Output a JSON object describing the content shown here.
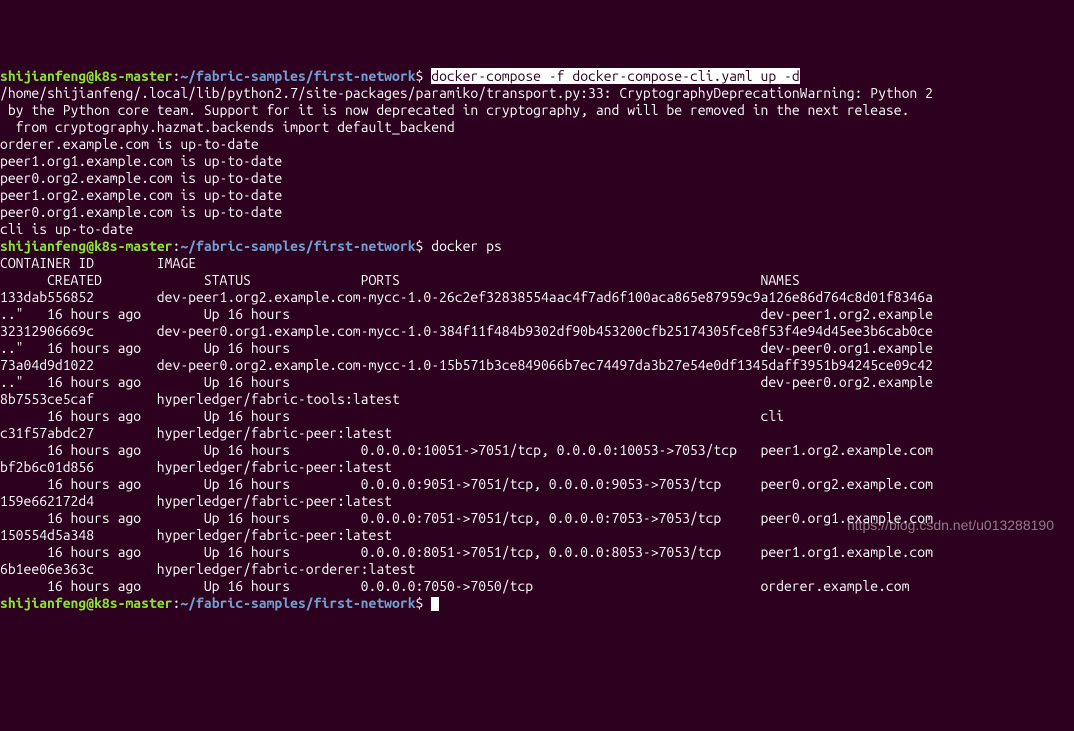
{
  "prompt": {
    "user": "shijianfeng",
    "at": "@",
    "host": "k8s-master",
    "colon": ":",
    "path": "~/fabric-samples/first-network",
    "dollar": "$"
  },
  "cmd1_hl": "docker-compose -f docker-compose-cli.yaml up -d",
  "warn_line1": "/home/shijianfeng/.local/lib/python2.7/site-packages/paramiko/transport.py:33: CryptographyDeprecationWarning: Python 2",
  "warn_line2": " by the Python core team. Support for it is now deprecated in cryptography, and will be removed in the next release.",
  "warn_line3": "  from cryptography.hazmat.backends import default_backend",
  "up": [
    "orderer.example.com is up-to-date",
    "peer1.org1.example.com is up-to-date",
    "peer0.org2.example.com is up-to-date",
    "peer1.org2.example.com is up-to-date",
    "peer0.org1.example.com is up-to-date",
    "cli is up-to-date"
  ],
  "cmd2": "docker ps",
  "ps_head1": "CONTAINER ID        IMAGE                                                                                                             ",
  "ps_head2": "      CREATED             STATUS              PORTS                                              NAMES",
  "rows": [
    {
      "a": "133dab556852        dev-peer1.org2.example.com-mycc-1.0-26c2ef32838554aac4f7ad6f100aca865e87959c9a126e86d764c8d01f8346a",
      "b": "..\"   16 hours ago        Up 16 hours                                                            dev-peer1.org2.example"
    },
    {
      "a": "32312906669c        dev-peer0.org1.example.com-mycc-1.0-384f11f484b9302df90b453200cfb25174305fce8f53f4e94d45ee3b6cab0ce",
      "b": "..\"   16 hours ago        Up 16 hours                                                            dev-peer0.org1.example"
    },
    {
      "a": "73a04d9d1022        dev-peer0.org2.example.com-mycc-1.0-15b571b3ce849066b7ec74497da3b27e54e0df1345daff3951b94245ce09c42",
      "b": "..\"   16 hours ago        Up 16 hours                                                            dev-peer0.org2.example"
    },
    {
      "a": "8b7553ce5caf        hyperledger/fabric-tools:latest                                                                   ",
      "b": "      16 hours ago        Up 16 hours                                                            cli"
    },
    {
      "a": "c31f57abdc27        hyperledger/fabric-peer:latest                                                                    ",
      "b": "      16 hours ago        Up 16 hours         0.0.0.0:10051->7051/tcp, 0.0.0.0:10053->7053/tcp   peer1.org2.example.com"
    },
    {
      "a": "bf2b6c01d856        hyperledger/fabric-peer:latest                                                                    ",
      "b": "      16 hours ago        Up 16 hours         0.0.0.0:9051->7051/tcp, 0.0.0.0:9053->7053/tcp     peer0.org2.example.com"
    },
    {
      "a": "159e662172d4        hyperledger/fabric-peer:latest                                                                    ",
      "b": "      16 hours ago        Up 16 hours         0.0.0.0:7051->7051/tcp, 0.0.0.0:7053->7053/tcp     peer0.org1.example.com"
    },
    {
      "a": "150554d5a348        hyperledger/fabric-peer:latest                                                                    ",
      "b": "      16 hours ago        Up 16 hours         0.0.0.0:8051->7051/tcp, 0.0.0.0:8053->7053/tcp     peer1.org1.example.com"
    },
    {
      "a": "6b1ee06e363c        hyperledger/fabric-orderer:latest                                                                 ",
      "b": "      16 hours ago        Up 16 hours         0.0.0.0:7050->7050/tcp                             orderer.example.com"
    }
  ],
  "watermark": "https://blog.csdn.net/u013288190"
}
